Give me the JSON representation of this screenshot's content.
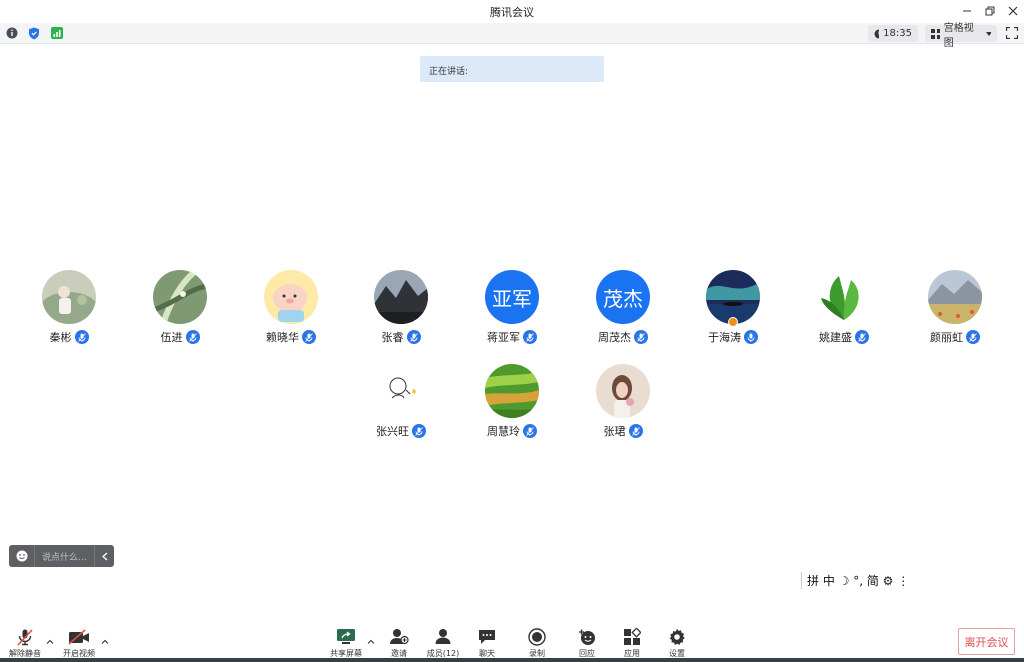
{
  "window": {
    "title": "腾讯会议"
  },
  "topbar": {
    "time": "18:35",
    "view_label": "宫格视图"
  },
  "speaking": {
    "label": "正在讲话:"
  },
  "participants": [
    {
      "name": "秦彬",
      "avatar": "photo-girl-green"
    },
    {
      "name": "伍进",
      "avatar": "photo-leaf-drops"
    },
    {
      "name": "赖晓华",
      "avatar": "cartoon-pig"
    },
    {
      "name": "张睿",
      "avatar": "photo-mountains"
    },
    {
      "name": "蒋亚军",
      "avatar_text": "亚军"
    },
    {
      "name": "周茂杰",
      "avatar_text": "茂杰"
    },
    {
      "name": "于海涛",
      "avatar": "photo-aurora",
      "host": true
    },
    {
      "name": "姚建盛",
      "avatar": "photo-green-plant"
    },
    {
      "name": "颜丽虹",
      "avatar": "photo-flower-field"
    },
    {
      "name": "张兴旺",
      "avatar": "sketch-character"
    },
    {
      "name": "周慧玲",
      "avatar": "photo-green-fields"
    },
    {
      "name": "张珺",
      "avatar": "photo-girl-flowers"
    }
  ],
  "chat": {
    "placeholder": "说点什么..."
  },
  "ime": {
    "text": "拼 中 ☽ °, 简 ⚙ ⋮"
  },
  "bottom": {
    "unmute": "解除静音",
    "start_video": "开启视频",
    "share": "共享屏幕",
    "invite": "邀请",
    "members": "成员(12)",
    "chat": "聊天",
    "record": "录制",
    "replay": "回应",
    "apps": "应用",
    "settings": "设置",
    "leave": "离开会议"
  },
  "colors": {
    "accent": "#1a73f0",
    "leave": "#e34d4d",
    "banner": "#dce9f8"
  }
}
